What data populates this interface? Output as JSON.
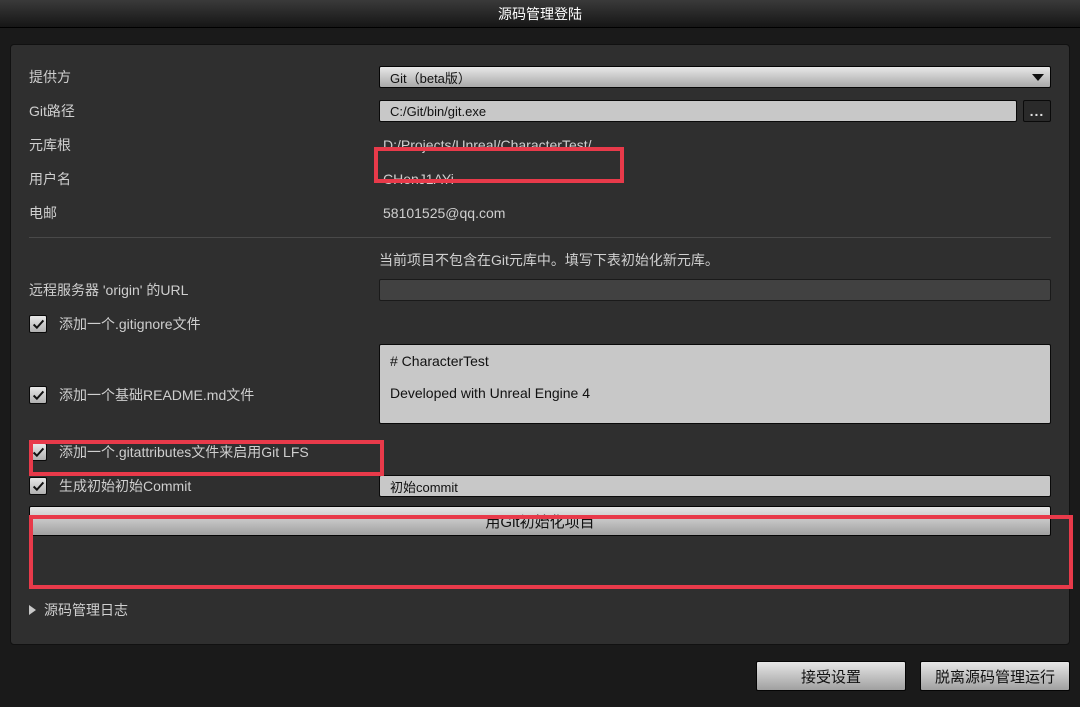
{
  "title": "源码管理登陆",
  "labels": {
    "provider": "提供方",
    "git_path": "Git路径",
    "repo_root": "元库根",
    "username": "用户名",
    "email": "电邮",
    "origin_url": "远程服务器 'origin' 的URL",
    "add_gitignore": "添加一个.gitignore文件",
    "add_readme": "添加一个基础README.md文件",
    "add_gitattributes": "添加一个.gitattributes文件来启用Git LFS",
    "initial_commit": "生成初始初始Commit",
    "log": "源码管理日志"
  },
  "values": {
    "provider_selected": "Git（beta版）",
    "git_path": "C:/Git/bin/git.exe",
    "repo_root": "D:/Projects/Unreal/CharacterTest/",
    "username": "CHenJ1AYi",
    "email": "58101525@qq.com",
    "origin_url": "",
    "readme_text": "# CharacterTest\n\nDeveloped with Unreal Engine 4",
    "initial_commit_msg": "初始commit"
  },
  "status_text": "当前项目不包含在Git元库中。填写下表初始化新元库。",
  "buttons": {
    "browse": "...",
    "init": "用Git初始化项目",
    "accept": "接受设置",
    "run_without": "脱离源码管理运行"
  },
  "checks": {
    "gitignore": true,
    "readme": true,
    "gitattributes": true,
    "initial_commit": true
  }
}
